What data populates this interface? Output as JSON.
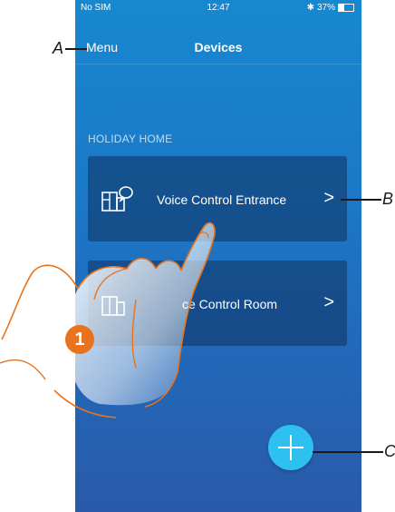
{
  "status_bar": {
    "carrier": "No SIM",
    "time": "12:47",
    "battery": "37%",
    "battery_level": 0.37
  },
  "nav": {
    "menu_label": "Menu",
    "title": "Devices"
  },
  "section": {
    "label": "HOLIDAY HOME"
  },
  "devices": [
    {
      "name": "Voice Control Entrance"
    },
    {
      "name": "ce Control Room"
    }
  ],
  "fab": {
    "icon": "plus-icon"
  },
  "callouts": {
    "a": "A",
    "b": "B",
    "c": "C"
  },
  "step": {
    "number": "1"
  },
  "colors": {
    "background_top": "#1788d0",
    "background_bottom": "#2a5aa9",
    "fab": "#2ec0ef",
    "step_badge": "#e8731c"
  }
}
